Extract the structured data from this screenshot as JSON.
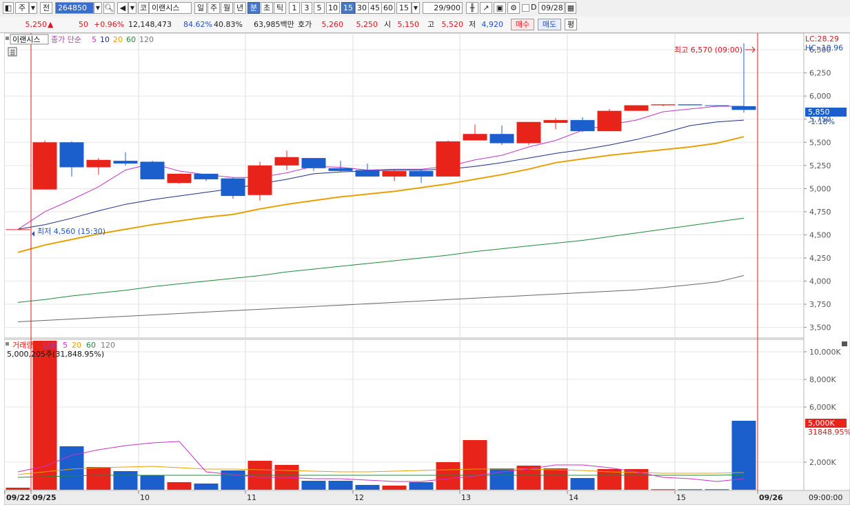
{
  "toolbar": {
    "market_type": "주",
    "market_type2": "전",
    "code": "264850",
    "stock_name": "이랜시스",
    "stock_prefix": "코",
    "period_tabs": [
      "일",
      "주",
      "월",
      "년",
      "분",
      "초",
      "틱"
    ],
    "active_period": "분",
    "intervals": [
      "1",
      "3",
      "5",
      "10",
      "15",
      "30",
      "45",
      "60"
    ],
    "active_interval": "15",
    "interval_value": "15",
    "count": "29",
    "count_total": "/900",
    "date": "09/28",
    "d_label": "D"
  },
  "quote": {
    "price": "5,250",
    "change_arrow": "▲",
    "change": "50",
    "change_pct": "+0.96%",
    "volume": "12,148,473",
    "ratio1": "84.62%",
    "ratio2": "40.83%",
    "amount": "63,985백만",
    "bid_label": "호가",
    "ask": "5,260",
    "bid": "5,250",
    "open_label": "시",
    "open": "5,150",
    "high_label": "고",
    "high": "5,520",
    "low_label": "저",
    "low": "4,920",
    "buy_label": "매수",
    "sell_label": "매도",
    "eval_label": "평"
  },
  "price_panel": {
    "title": "이랜시스",
    "ma_label": "종가 단순",
    "ma_periods": [
      "5",
      "10",
      "20",
      "60",
      "120"
    ],
    "lc": "LC:28.29",
    "hc": "HC:-10.96",
    "max_label": "최고 6,570 (09:00)",
    "min_label": "최저 4,560 (15:30)",
    "last_price": "5,850",
    "last_pct": "-1.18%",
    "y_ticks": [
      "6,500",
      "6,250",
      "6,000",
      "5,750",
      "5,500",
      "5,250",
      "5,000",
      "4,750",
      "4,500",
      "4,250",
      "4,000",
      "3,750",
      "3,500"
    ]
  },
  "volume_panel": {
    "title": "거래량",
    "ma_label": "단순",
    "ma_periods": [
      "5",
      "20",
      "60",
      "120"
    ],
    "info": "5,000,205주(31,848.95%)",
    "last_volume": "5,000K",
    "last_pct": "31848.95%",
    "y_ticks": [
      "10,000K",
      "8,000K",
      "6,000K",
      "2,000K"
    ]
  },
  "x_axis": {
    "labels": [
      "09/22",
      "09/25",
      "10",
      "11",
      "12",
      "13",
      "14",
      "15",
      "09/26"
    ],
    "time": "09:00:00"
  },
  "colors": {
    "up": "#e8231a",
    "down": "#1b5fcc",
    "ma5": "#c832c8",
    "ma10": "#1a2f8a",
    "ma20": "#e8a000",
    "ma60": "#1e8a3c",
    "ma120": "#666666",
    "cursor": "#e0141e"
  },
  "chart_data": {
    "type": "candlestick",
    "candles": [
      {
        "o": 4560,
        "h": 4560,
        "l": 4560,
        "c": 4560
      },
      {
        "o": 4990,
        "h": 5520,
        "l": 4990,
        "c": 5500
      },
      {
        "o": 5500,
        "h": 5510,
        "l": 5130,
        "c": 5230
      },
      {
        "o": 5310,
        "h": 5330,
        "l": 5150,
        "c": 5230
      },
      {
        "o": 5300,
        "h": 5390,
        "l": 5250,
        "c": 5270
      },
      {
        "o": 5290,
        "h": 5300,
        "l": 5100,
        "c": 5100
      },
      {
        "o": 5060,
        "h": 5160,
        "l": 5050,
        "c": 5160
      },
      {
        "o": 5100,
        "h": 5160,
        "l": 5080,
        "c": 5160
      },
      {
        "o": 4920,
        "h": 5120,
        "l": 4890,
        "c": 5110
      },
      {
        "o": 4930,
        "h": 5290,
        "l": 4870,
        "c": 5250
      },
      {
        "o": 5250,
        "h": 5410,
        "l": 5200,
        "c": 5340
      },
      {
        "o": 5330,
        "h": 5330,
        "l": 5190,
        "c": 5220
      },
      {
        "o": 5220,
        "h": 5300,
        "l": 5180,
        "c": 5190
      },
      {
        "o": 5200,
        "h": 5270,
        "l": 5130,
        "c": 5130
      },
      {
        "o": 5130,
        "h": 5200,
        "l": 5080,
        "c": 5190
      },
      {
        "o": 5190,
        "h": 5210,
        "l": 5060,
        "c": 5130
      },
      {
        "o": 5130,
        "h": 5520,
        "l": 5130,
        "c": 5510
      },
      {
        "o": 5520,
        "h": 5690,
        "l": 5520,
        "c": 5590
      },
      {
        "o": 5590,
        "h": 5680,
        "l": 5470,
        "c": 5490
      },
      {
        "o": 5490,
        "h": 5720,
        "l": 5470,
        "c": 5720
      },
      {
        "o": 5710,
        "h": 5760,
        "l": 5640,
        "c": 5740
      },
      {
        "o": 5740,
        "h": 5770,
        "l": 5610,
        "c": 5620
      },
      {
        "o": 5620,
        "h": 5860,
        "l": 5620,
        "c": 5840
      },
      {
        "o": 5840,
        "h": 5900,
        "l": 5840,
        "c": 5900
      },
      {
        "o": 5900,
        "h": 5910,
        "l": 5890,
        "c": 5910
      },
      {
        "o": 5910,
        "h": 5910,
        "l": 5900,
        "c": 5900
      },
      {
        "o": 5900,
        "h": 5900,
        "l": 5900,
        "c": 5900
      },
      {
        "o": 5890,
        "h": 6570,
        "l": 5820,
        "c": 5850
      }
    ],
    "candle_dir": [
      "u",
      "u",
      "d",
      "u",
      "d",
      "d",
      "u",
      "d",
      "d",
      "u",
      "u",
      "d",
      "d",
      "d",
      "u",
      "d",
      "u",
      "u",
      "d",
      "u",
      "u",
      "d",
      "u",
      "u",
      "u",
      "d",
      "d",
      "d"
    ],
    "volume": [
      150,
      11000,
      3150,
      1650,
      1350,
      1050,
      550,
      450,
      1400,
      2100,
      1800,
      650,
      650,
      350,
      300,
      550,
      2000,
      3600,
      1550,
      1750,
      1550,
      850,
      1500,
      1500,
      40,
      40,
      40,
      5000
    ],
    "ma5": [
      4560,
      4750,
      4880,
      5020,
      5200,
      5270,
      5190,
      5150,
      5120,
      5120,
      5170,
      5240,
      5230,
      5200,
      5210,
      5210,
      5240,
      5310,
      5360,
      5450,
      5520,
      5630,
      5690,
      5740,
      5830,
      5860,
      5890,
      5890
    ],
    "ma10": [
      4560,
      4610,
      4680,
      4760,
      4830,
      4880,
      4920,
      4960,
      5000,
      5050,
      5100,
      5160,
      5180,
      5190,
      5200,
      5200,
      5210,
      5240,
      5280,
      5330,
      5380,
      5420,
      5470,
      5530,
      5600,
      5680,
      5720,
      5740
    ],
    "ma20": [
      4310,
      4390,
      4450,
      4510,
      4560,
      4610,
      4650,
      4690,
      4720,
      4780,
      4830,
      4870,
      4910,
      4940,
      4970,
      5010,
      5050,
      5100,
      5150,
      5210,
      5280,
      5320,
      5360,
      5390,
      5420,
      5450,
      5490,
      5560
    ],
    "ma60": [
      3770,
      3800,
      3840,
      3870,
      3900,
      3940,
      3970,
      4000,
      4030,
      4060,
      4100,
      4130,
      4160,
      4190,
      4220,
      4250,
      4280,
      4320,
      4350,
      4380,
      4410,
      4440,
      4480,
      4520,
      4560,
      4600,
      4640,
      4680
    ],
    "ma120": [
      3560,
      3575,
      3590,
      3605,
      3620,
      3635,
      3650,
      3665,
      3680,
      3695,
      3710,
      3725,
      3740,
      3755,
      3770,
      3785,
      3800,
      3815,
      3830,
      3845,
      3860,
      3875,
      3890,
      3905,
      3930,
      3960,
      3990,
      4060
    ],
    "vma5": [
      1300,
      1700,
      2500,
      2900,
      3200,
      3400,
      3500,
      1300,
      1100,
      900,
      900,
      800,
      800,
      700,
      600,
      600,
      800,
      1000,
      1300,
      1500,
      1800,
      1800,
      1600,
      1300,
      900,
      800,
      600,
      800
    ],
    "vma20": [
      1100,
      1300,
      1500,
      1600,
      1650,
      1700,
      1600,
      1500,
      1500,
      1450,
      1400,
      1350,
      1300,
      1300,
      1350,
      1400,
      1450,
      1500,
      1500,
      1500,
      1450,
      1400,
      1300,
      1250,
      1200,
      1200,
      1200,
      1250
    ],
    "vma60": [
      900,
      950,
      1000,
      1050,
      1050,
      1050,
      1050,
      1050,
      1050,
      1050,
      1050,
      1050,
      1050,
      1050,
      1050,
      1050,
      1050,
      1050,
      1050,
      1050,
      1050,
      1050,
      1050,
      1050,
      1050,
      1050,
      1050,
      1100
    ],
    "price_ylim": [
      3400,
      6650
    ],
    "volume_ylim": [
      0,
      10800
    ]
  }
}
